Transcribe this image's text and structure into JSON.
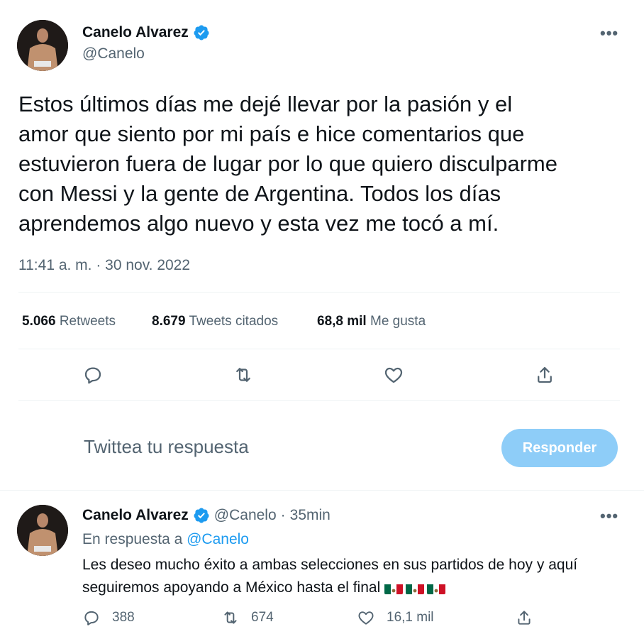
{
  "main_tweet": {
    "author_name": "Canelo Alvarez",
    "author_handle": "@Canelo",
    "text_lines": [
      "Estos últimos días me dejé llevar por la pasión y el",
      "amor que siento por mi país e hice comentarios que",
      "estuvieron fuera de lugar por lo que quiero disculparme",
      "con Messi y la gente de Argentina. Todos los días",
      "aprendemos algo nuevo y esta vez me tocó a mí."
    ],
    "timestamp": "11:41 a. m. · 30 nov. 2022",
    "stats": {
      "retweets_count": "5.066",
      "retweets_label": "Retweets",
      "quotes_count": "8.679",
      "quotes_label": "Tweets citados",
      "likes_count": "68,8 mil",
      "likes_label": "Me gusta"
    }
  },
  "reply_box": {
    "placeholder": "Twittea tu respuesta",
    "button_label": "Responder"
  },
  "reply_tweet": {
    "author_name": "Canelo Alvarez",
    "author_handle": "@Canelo",
    "separator": "·",
    "time": "35min",
    "reply_to_prefix": "En respuesta a",
    "reply_to_handle": "@Canelo",
    "text_line1": "Les deseo mucho éxito a ambas selecciones en sus partidos de hoy y aquí",
    "text_line2": "seguiremos apoyando a México hasta el final",
    "flags": [
      "mexico-flag",
      "mexico-flag",
      "mexico-flag"
    ],
    "replies": "388",
    "retweets": "674",
    "likes": "16,1 mil"
  },
  "colors": {
    "accent": "#1d9bf0",
    "button_disabled": "#8ecdf8",
    "secondary_text": "#536471",
    "divider": "#eff3f4"
  }
}
